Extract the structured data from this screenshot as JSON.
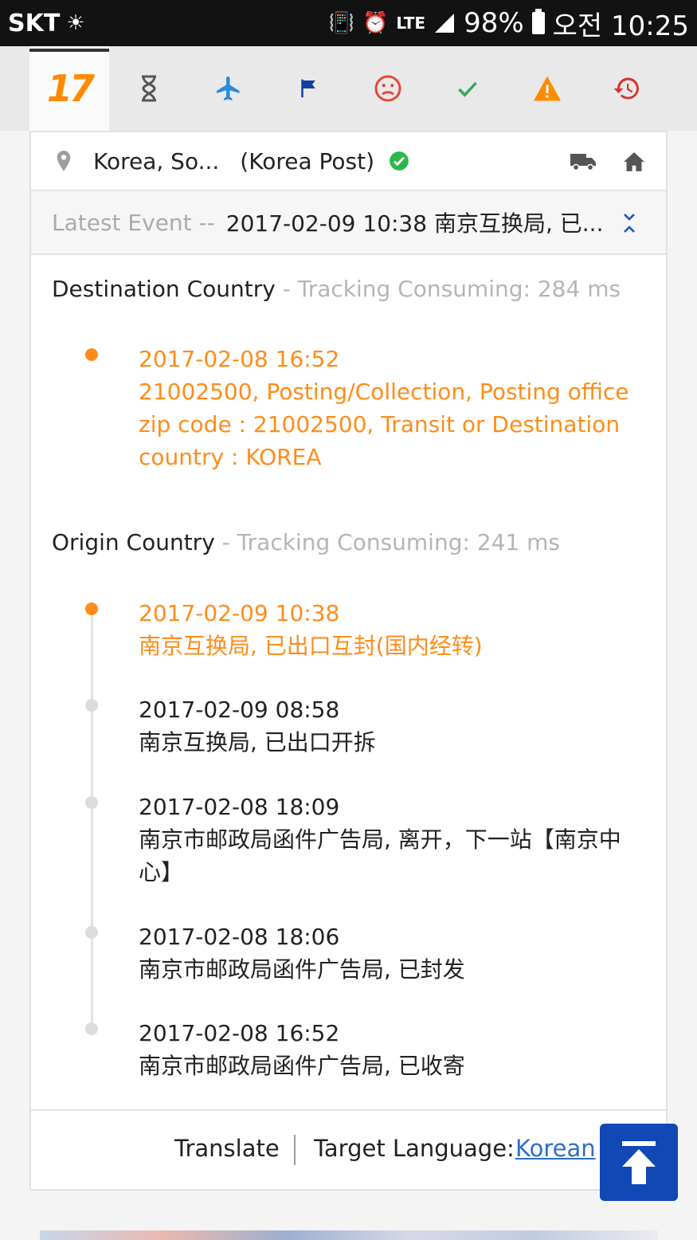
{
  "status_bar": {
    "carrier": "SKT",
    "battery": "98%",
    "network": "LTE",
    "time": "오전 10:25"
  },
  "tabs": [
    {
      "name": "logo",
      "label": "17",
      "icon": "17track-logo",
      "active": true,
      "color": "#ff8a00"
    },
    {
      "name": "pending",
      "icon": "hourglass-icon",
      "color": "#555555"
    },
    {
      "name": "in-transit",
      "icon": "airplane-icon",
      "color": "#2b8ad9"
    },
    {
      "name": "pickup",
      "icon": "flag-icon",
      "color": "#123fa0"
    },
    {
      "name": "undelivered",
      "icon": "sad-face-icon",
      "color": "#e5483b"
    },
    {
      "name": "delivered",
      "icon": "checkmark-icon",
      "color": "#3aa55a"
    },
    {
      "name": "alert",
      "icon": "warning-icon",
      "color": "#ff8a00"
    },
    {
      "name": "expired",
      "icon": "history-icon",
      "color": "#d9332b"
    }
  ],
  "carrier_row": {
    "country": "Korea, So...",
    "carrier": "(Korea Post)"
  },
  "latest": {
    "label": "Latest Event --",
    "event": "2017-02-09 10:38 南京互换局, 已..."
  },
  "destination": {
    "title": "Destination Country",
    "consuming": " - Tracking Consuming: 284 ms",
    "events": [
      {
        "time": "2017-02-08 16:52",
        "text": "21002500, Posting/Collection, Posting office zip code : 21002500, Transit or Destination country : KOREA"
      }
    ]
  },
  "origin": {
    "title": "Origin Country",
    "consuming": " - Tracking Consuming: 241 ms",
    "events": [
      {
        "time": "2017-02-09 10:38",
        "text": "南京互换局, 已出口互封(国内经转)"
      },
      {
        "time": "2017-02-09 08:58",
        "text": "南京互换局, 已出口开拆"
      },
      {
        "time": "2017-02-08 18:09",
        "text": "南京市邮政局函件广告局, 离开，下一站【南京中心】"
      },
      {
        "time": "2017-02-08 18:06",
        "text": "南京市邮政局函件广告局, 已封发"
      },
      {
        "time": "2017-02-08 16:52",
        "text": "南京市邮政局函件广告局, 已收寄"
      }
    ]
  },
  "footer": {
    "translate": "Translate",
    "target_label": "Target Language:",
    "target_value": "Korean"
  },
  "colors": {
    "accent_orange": "#ff8c1a",
    "link_blue": "#2c6fc8",
    "scroll_button": "#1148b6"
  }
}
